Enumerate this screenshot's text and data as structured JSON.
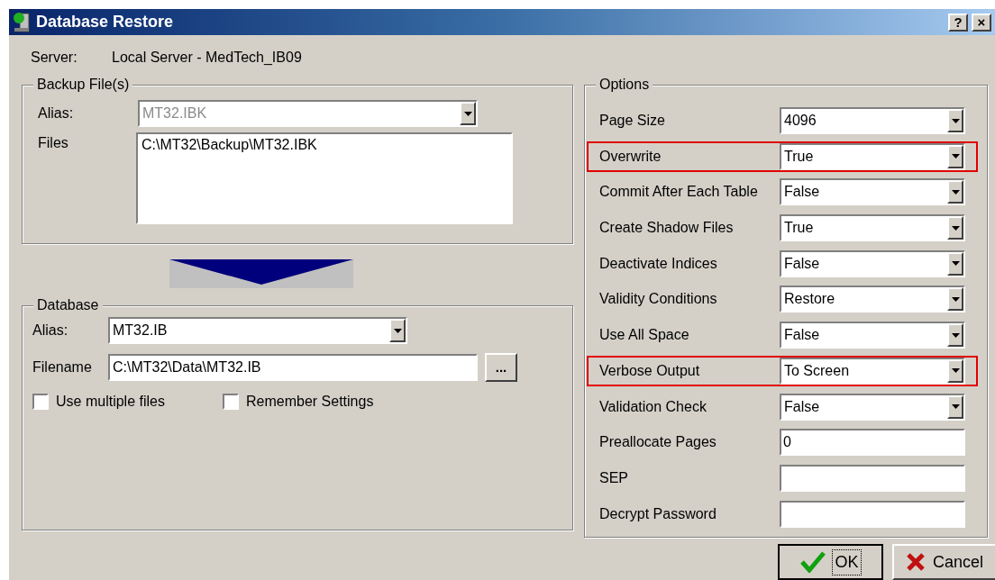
{
  "window": {
    "title": "Database Restore",
    "controls": [
      "?",
      "×"
    ]
  },
  "server": {
    "label": "Server:",
    "value": "Local Server - MedTech_IB09"
  },
  "backup": {
    "title": "Backup File(s)",
    "alias_label": "Alias:",
    "alias_value": "MT32.IBK",
    "alias_disabled": true,
    "files_label": "Files",
    "files": [
      "C:\\MT32\\Backup\\MT32.IBK"
    ]
  },
  "database": {
    "title": "Database",
    "alias_label": "Alias:",
    "alias_value": "MT32.IB",
    "filename_label": "Filename",
    "filename_value": "C:\\MT32\\Data\\MT32.IB",
    "browse": "...",
    "checkboxes": [
      {
        "label": "Use multiple files",
        "checked": false
      },
      {
        "label": "Remember Settings",
        "checked": false
      }
    ]
  },
  "options": {
    "title": "Options",
    "rows": [
      {
        "label": "Page Size",
        "kind": "select",
        "value": "4096",
        "highlighted": false
      },
      {
        "label": "Overwrite",
        "kind": "select",
        "value": "True",
        "highlighted": true
      },
      {
        "label": "Commit After Each Table",
        "kind": "select",
        "value": "False",
        "highlighted": false
      },
      {
        "label": "Create Shadow Files",
        "kind": "select",
        "value": "True",
        "highlighted": false
      },
      {
        "label": "Deactivate Indices",
        "kind": "select",
        "value": "False",
        "highlighted": false
      },
      {
        "label": "Validity Conditions",
        "kind": "select",
        "value": "Restore",
        "highlighted": false
      },
      {
        "label": "Use All Space",
        "kind": "select",
        "value": "False",
        "highlighted": false
      },
      {
        "label": "Verbose Output",
        "kind": "select",
        "value": "To Screen",
        "highlighted": true
      },
      {
        "label": "Validation Check",
        "kind": "select",
        "value": "False",
        "highlighted": false
      },
      {
        "label": "Preallocate Pages",
        "kind": "text",
        "value": "0",
        "highlighted": false
      },
      {
        "label": "SEP",
        "kind": "text",
        "highlighted": false
      },
      {
        "label": "Decrypt Password",
        "kind": "text",
        "highlighted": false
      }
    ]
  },
  "buttons": [
    {
      "label": "OK",
      "kind": "ok",
      "default": true
    },
    {
      "label": "Cancel",
      "kind": "cancel",
      "default": false
    }
  ]
}
